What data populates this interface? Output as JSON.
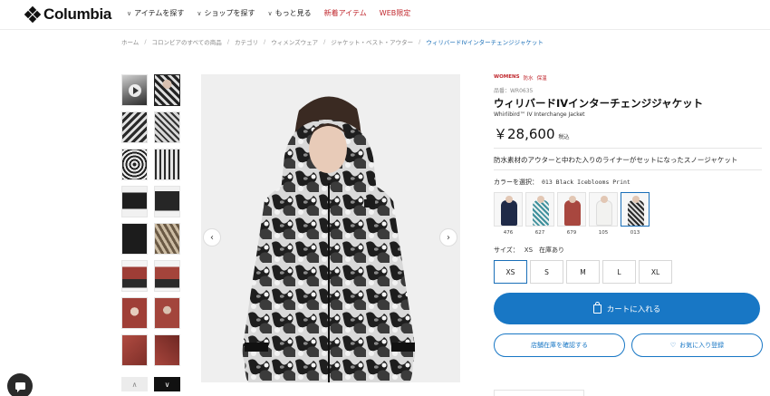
{
  "header": {
    "brand": "Columbia",
    "nav": [
      {
        "label": "アイテムを探す",
        "chevron": true,
        "red": false
      },
      {
        "label": "ショップを探す",
        "chevron": true,
        "red": false
      },
      {
        "label": "もっと見る",
        "chevron": true,
        "red": false
      },
      {
        "label": "新着アイテム",
        "chevron": false,
        "red": true
      },
      {
        "label": "WEB限定",
        "chevron": false,
        "red": true
      }
    ]
  },
  "breadcrumb": [
    "ホーム",
    "コロンビアのすべての商品",
    "カテゴリ",
    "ウィメンズウェア",
    "ジャケット・ベスト・アウター",
    "ウィリバードIVインターチェンジジャケット"
  ],
  "product": {
    "gender_tag": "WOMENS",
    "feature_tags": [
      "防水",
      "保温"
    ],
    "sku": "品番：WR0635",
    "title": "ウィリバードIVインターチェンジジャケット",
    "subtitle": "Whirlibird™ IV Interchange Jacket",
    "price": "￥28,600",
    "tax_note": "税込",
    "catchcopy": "防水素材のアウターと中わた入りのライナーがセットになったスノージャケット",
    "color_label": "カラーを選択：",
    "color_value": "013 Black Iceblooms Print",
    "colors": [
      {
        "code": "476",
        "hex": "#1f2a48"
      },
      {
        "code": "627",
        "hex": "#3d8f9a"
      },
      {
        "code": "679",
        "hex": "#a8473f"
      },
      {
        "code": "105",
        "hex": "#f2f2f0"
      },
      {
        "code": "013",
        "hex": "#3a3a3a"
      }
    ],
    "size_label": "サイズ：",
    "size_value": "XS　在庫あり",
    "sizes": [
      "XS",
      "S",
      "M",
      "L",
      "XL"
    ],
    "cart_label": "カートに入れる",
    "store_stock_label": "店舗在庫を確認する",
    "favorite_label": "お気に入り登録"
  },
  "colors": {
    "accent": "#1877c5",
    "red": "#c0272d"
  }
}
